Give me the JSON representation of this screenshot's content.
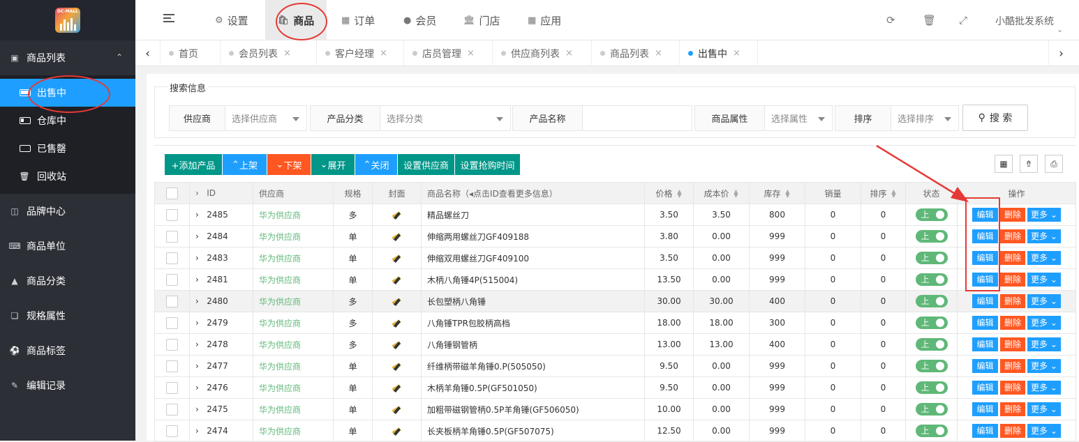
{
  "app": {
    "logo_text": "DC-MALL",
    "system_name": "小酷批发系统"
  },
  "topnav": [
    {
      "label": "设置",
      "icon": "gear-icon"
    },
    {
      "label": "商品",
      "icon": "bag-icon",
      "active": true
    },
    {
      "label": "订单",
      "icon": "table-icon"
    },
    {
      "label": "会员",
      "icon": "user-icon"
    },
    {
      "label": "门店",
      "icon": "bank-icon"
    },
    {
      "label": "应用",
      "icon": "grid-icon"
    }
  ],
  "sidebar": {
    "group_open": "商品列表",
    "subitems": [
      "出售中",
      "仓库中",
      "已售罄",
      "回收站"
    ],
    "groups": [
      "品牌中心",
      "商品单位",
      "商品分类",
      "规格属性",
      "商品标签",
      "编辑记录"
    ]
  },
  "tabs": [
    "首页",
    "会员列表",
    "客户经理",
    "店员管理",
    "供应商列表",
    "商品列表",
    "出售中"
  ],
  "search": {
    "legend": "搜索信息",
    "fields": [
      {
        "label": "供应商",
        "value": "选择供应商"
      },
      {
        "label": "产品分类",
        "value": "选择分类"
      },
      {
        "label": "产品名称",
        "value": ""
      },
      {
        "label": "商品属性",
        "value": "选择属性"
      },
      {
        "label": "排序",
        "value": "选择排序"
      }
    ],
    "button": "搜 索"
  },
  "actions": [
    "+添加产品",
    "上架",
    "下架",
    "展开",
    "关闭",
    "设置供应商",
    "设置抢购时间"
  ],
  "action_colors": [
    "#009688",
    "#1e9fff",
    "#ff5722",
    "#009688",
    "#1e9fff",
    "#009688",
    "#009688"
  ],
  "table": {
    "headers": [
      "ID",
      "供应商",
      "规格",
      "封面",
      "商品名称（◂点击ID查看更多信息）",
      "价格",
      "成本价",
      "库存",
      "销量",
      "排序",
      "状态",
      "操作"
    ],
    "rows": [
      {
        "id": "2485",
        "supplier": "华为供应商",
        "spec": "多",
        "name": "精品螺丝刀",
        "price": "3.50",
        "cost": "3.50",
        "stock": "800",
        "sales": "0",
        "sort": "0"
      },
      {
        "id": "2484",
        "supplier": "华为供应商",
        "spec": "单",
        "name": "伸缩两用螺丝刀GF409188",
        "price": "3.80",
        "cost": "0.00",
        "stock": "999",
        "sales": "0",
        "sort": "0"
      },
      {
        "id": "2483",
        "supplier": "华为供应商",
        "spec": "单",
        "name": "伸缩双用螺丝刀GF409100",
        "price": "3.50",
        "cost": "0.00",
        "stock": "999",
        "sales": "0",
        "sort": "0"
      },
      {
        "id": "2481",
        "supplier": "华为供应商",
        "spec": "单",
        "name": "木柄八角锤4P(515004)",
        "price": "13.50",
        "cost": "0.00",
        "stock": "999",
        "sales": "0",
        "sort": "0"
      },
      {
        "id": "2480",
        "supplier": "华为供应商",
        "spec": "多",
        "name": "长包塑柄八角锤",
        "price": "30.00",
        "cost": "30.00",
        "stock": "400",
        "sales": "0",
        "sort": "0"
      },
      {
        "id": "2479",
        "supplier": "华为供应商",
        "spec": "多",
        "name": "八角锤TPR包胶柄高档",
        "price": "18.00",
        "cost": "18.00",
        "stock": "300",
        "sales": "0",
        "sort": "0"
      },
      {
        "id": "2478",
        "supplier": "华为供应商",
        "spec": "多",
        "name": "八角锤钢管柄",
        "price": "13.00",
        "cost": "13.00",
        "stock": "400",
        "sales": "0",
        "sort": "0"
      },
      {
        "id": "2477",
        "supplier": "华为供应商",
        "spec": "单",
        "name": "纤维柄带磁羊角锤0.P(505050)",
        "price": "9.50",
        "cost": "0.00",
        "stock": "999",
        "sales": "0",
        "sort": "0"
      },
      {
        "id": "2476",
        "supplier": "华为供应商",
        "spec": "单",
        "name": "木柄羊角锤0.5P(GF501050)",
        "price": "9.50",
        "cost": "0.00",
        "stock": "999",
        "sales": "0",
        "sort": "0"
      },
      {
        "id": "2475",
        "supplier": "华为供应商",
        "spec": "单",
        "name": "加粗带磁钢管柄0.5P羊角锤(GF506050)",
        "price": "10.00",
        "cost": "0.00",
        "stock": "999",
        "sales": "0",
        "sort": "0"
      },
      {
        "id": "2474",
        "supplier": "华为供应商",
        "spec": "单",
        "name": "长夹板柄羊角锤0.5P(GF507075)",
        "price": "12.50",
        "cost": "0.00",
        "stock": "999",
        "sales": "0",
        "sort": "0"
      }
    ],
    "status_label": "上",
    "op_edit": "编辑",
    "op_delete": "删除",
    "op_more": "更多"
  },
  "colors": {
    "sidebar_bg": "#2c2f36",
    "accent": "#1e9fff",
    "green": "#5fb878",
    "danger": "#ff5722",
    "annotation": "#e53935"
  }
}
